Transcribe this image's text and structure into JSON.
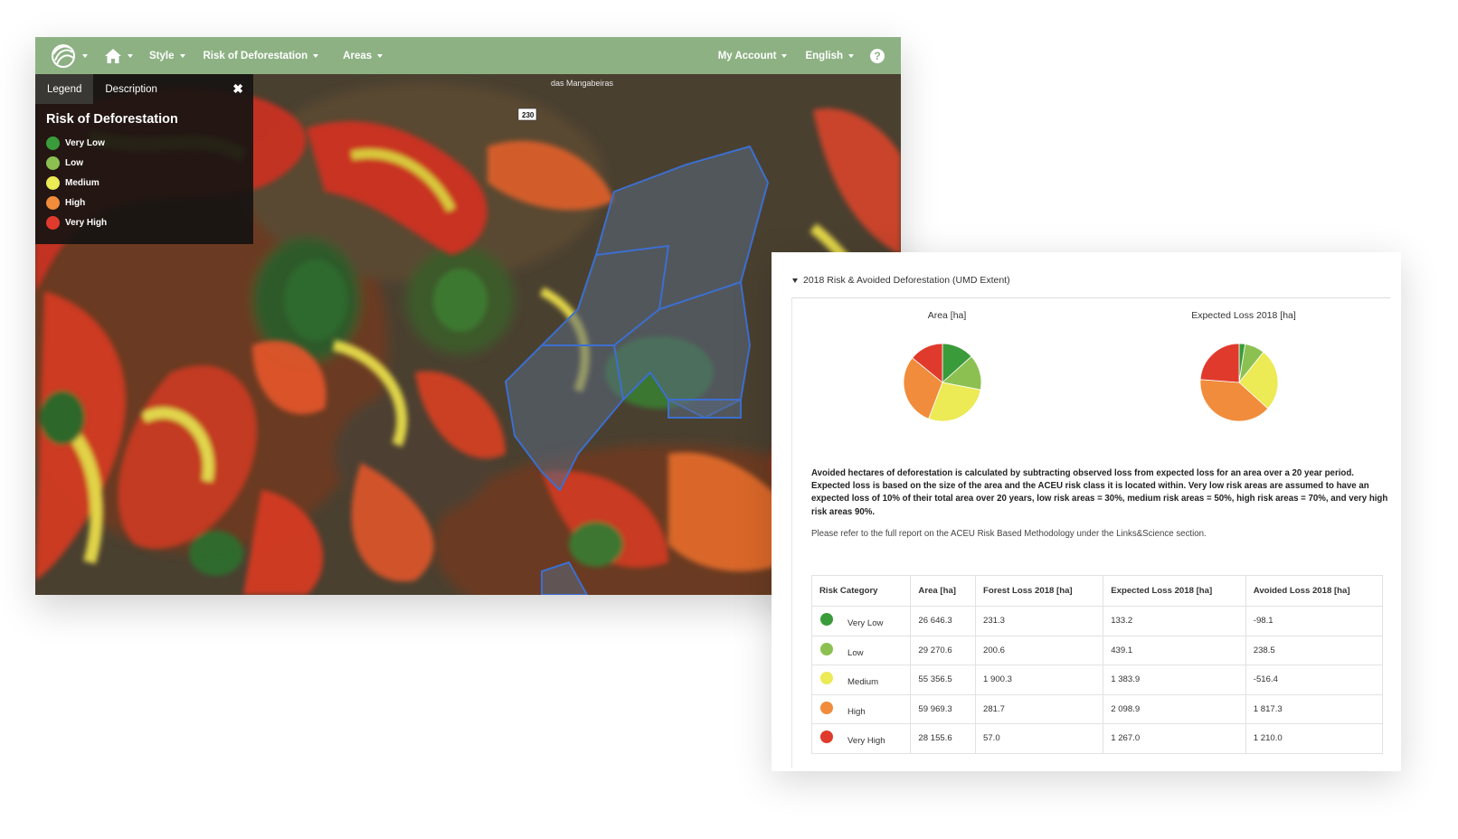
{
  "navbar": {
    "style_label": "Style",
    "risk_label": "Risk of Deforestation",
    "areas_label": "Areas",
    "account_label": "My Account",
    "language_label": "English",
    "help_label": "?"
  },
  "map": {
    "place_labels": [
      "das Mangabeiras",
      "230"
    ]
  },
  "legend": {
    "tabs": [
      "Legend",
      "Description"
    ],
    "close_label": "✖",
    "title": "Risk of Deforestation",
    "items": [
      {
        "label": "Very Low",
        "color": "#3a9b3a"
      },
      {
        "label": "Low",
        "color": "#8cc152"
      },
      {
        "label": "Medium",
        "color": "#ecea55"
      },
      {
        "label": "High",
        "color": "#f08c3b"
      },
      {
        "label": "Very High",
        "color": "#e03a2c"
      }
    ]
  },
  "report": {
    "section_title": "2018 Risk & Avoided Deforestation (UMD Extent)",
    "pie_area_title": "Area [ha]",
    "pie_loss_title": "Expected Loss 2018 [ha]",
    "note_1": "Avoided hectares of deforestation is calculated by subtracting observed loss from expected loss for an area over a 20 year period.",
    "note_2": "Expected loss is based on the size of the area and the ACEU risk class it is located within. Very low risk areas are assumed to have an expected loss of 10% of their total area over 20 years, low risk areas = 30%, medium risk areas = 50%, high risk areas = 70%, and very high risk areas 90%.",
    "note_3": "Please refer to the full report on the ACEU Risk Based Methodology under the Links&Science section.",
    "table": {
      "headers": [
        "Risk Category",
        "Area [ha]",
        "Forest Loss 2018 [ha]",
        "Expected Loss 2018 [ha]",
        "Avoided Loss 2018 [ha]"
      ],
      "rows": [
        {
          "category": "Very Low",
          "area": "26 646.3",
          "forest_loss": "231.3",
          "expected_loss": "133.2",
          "avoided_loss": "-98.1"
        },
        {
          "category": "Low",
          "area": "29 270.6",
          "forest_loss": "200.6",
          "expected_loss": "439.1",
          "avoided_loss": "238.5"
        },
        {
          "category": "Medium",
          "area": "55 356.5",
          "forest_loss": "1 900.3",
          "expected_loss": "1 383.9",
          "avoided_loss": "-516.4"
        },
        {
          "category": "High",
          "area": "59 969.3",
          "forest_loss": "281.7",
          "expected_loss": "2 098.9",
          "avoided_loss": "1 817.3"
        },
        {
          "category": "Very High",
          "area": "28 155.6",
          "forest_loss": "57.0",
          "expected_loss": "1 267.0",
          "avoided_loss": "1 210.0"
        }
      ]
    }
  },
  "chart_data": [
    {
      "type": "pie",
      "title": "Area [ha]",
      "categories": [
        "Very Low",
        "Low",
        "Medium",
        "High",
        "Very High"
      ],
      "values": [
        26646.3,
        29270.6,
        55356.5,
        59969.3,
        28155.6
      ],
      "colors": [
        "#3a9b3a",
        "#8cc152",
        "#ecea55",
        "#f08c3b",
        "#e03a2c"
      ]
    },
    {
      "type": "pie",
      "title": "Expected Loss 2018 [ha]",
      "categories": [
        "Very Low",
        "Low",
        "Medium",
        "High",
        "Very High"
      ],
      "values": [
        133.2,
        439.1,
        1383.9,
        2098.9,
        1267.0
      ],
      "colors": [
        "#3a9b3a",
        "#8cc152",
        "#ecea55",
        "#f08c3b",
        "#e03a2c"
      ]
    }
  ]
}
